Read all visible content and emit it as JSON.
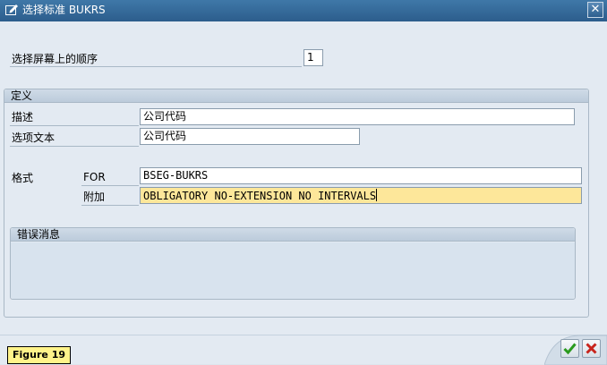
{
  "window": {
    "title": "选择标准 BUKRS"
  },
  "order": {
    "label": "选择屏幕上的顺序",
    "value": "1"
  },
  "definition": {
    "title": "定义",
    "description_label": "描述",
    "description_value": "公司代码",
    "option_text_label": "选项文本",
    "option_text_value": "公司代码",
    "format_label": "格式",
    "for_label": "FOR",
    "for_value": "BSEG-BUKRS",
    "addition_label": "附加",
    "addition_value": "OBLIGATORY NO-EXTENSION NO INTERVALS"
  },
  "error_messages": {
    "title": "错误消息"
  },
  "footer": {
    "figure_label": "Figure 19"
  },
  "colors": {
    "titlebar": "#2c5d8c",
    "highlight_field": "#fde79a",
    "confirm_green": "#2a9a1e",
    "cancel_red": "#c8241c"
  }
}
